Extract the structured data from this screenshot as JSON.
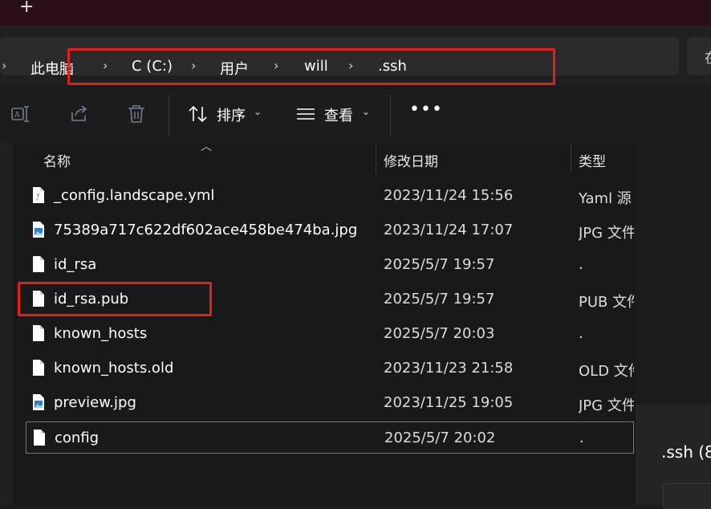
{
  "tabbar": {
    "new_tab_label": "+"
  },
  "breadcrumb": {
    "items": [
      "此电脑",
      "C (C:)",
      "用户",
      "will",
      ".ssh"
    ],
    "separator": "›"
  },
  "search": {
    "partial_text": "在"
  },
  "toolbar": {
    "sort_label": "排序",
    "view_label": "查看",
    "more_label": "•••",
    "icons": [
      "rename-icon",
      "share-icon",
      "delete-icon",
      "sort-icon",
      "view-icon",
      "more-icon"
    ]
  },
  "columns": {
    "name": "名称",
    "modified": "修改日期",
    "type": "类型"
  },
  "files": [
    {
      "name": "_config.landscape.yml",
      "modified": "2023/11/24 15:56",
      "type": "Yaml 源",
      "icon": "yaml-file-icon"
    },
    {
      "name": "75389a717c622df602ace458be474ba.jpg",
      "modified": "2023/11/24 17:07",
      "type": "JPG 文件",
      "icon": "image-file-icon"
    },
    {
      "name": "id_rsa",
      "modified": "2025/5/7 19:57",
      "type": ".",
      "icon": "file-icon"
    },
    {
      "name": "id_rsa.pub",
      "modified": "2025/5/7 19:57",
      "type": "PUB 文件",
      "icon": "file-icon"
    },
    {
      "name": "known_hosts",
      "modified": "2025/5/7 20:03",
      "type": ".",
      "icon": "file-icon"
    },
    {
      "name": "known_hosts.old",
      "modified": "2023/11/23 21:58",
      "type": "OLD 文件",
      "icon": "file-icon"
    },
    {
      "name": "preview.jpg",
      "modified": "2023/11/25 19:05",
      "type": "JPG 文件",
      "icon": "image-file-icon"
    },
    {
      "name": "config",
      "modified": "2025/5/7 20:02",
      "type": ".",
      "icon": "file-icon"
    }
  ],
  "details_pane": {
    "title": ".ssh (8"
  },
  "colors": {
    "annotation_red": "#e0201a",
    "tabbar_bg": "#2a0f17",
    "list_bg": "#191919"
  }
}
